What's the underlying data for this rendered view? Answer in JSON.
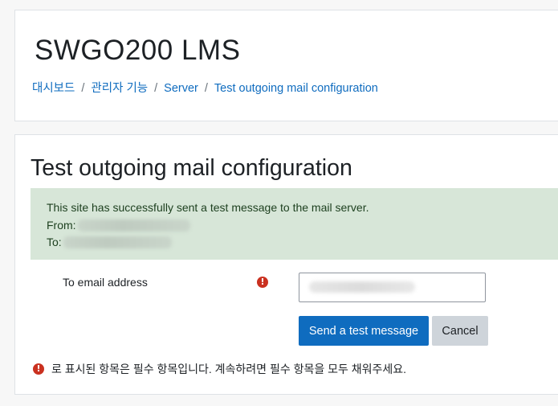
{
  "header": {
    "site_title": "SWGO200 LMS",
    "breadcrumb": [
      {
        "label": "대시보드"
      },
      {
        "label": "관리자 기능"
      },
      {
        "label": "Server"
      },
      {
        "label": "Test outgoing mail configuration"
      }
    ],
    "separator": "/"
  },
  "main": {
    "heading": "Test outgoing mail configuration",
    "alert": {
      "message": "This site has successfully sent a test message to the mail server.",
      "from_label": "From:",
      "to_label": "To:"
    },
    "form": {
      "email_label": "To email address",
      "email_value": "",
      "required_icon": "exclamation-circle-icon",
      "send_button": "Send a test message",
      "cancel_button": "Cancel",
      "required_note": "로 표시된 항목은 필수 항목입니다. 계속하려면 필수 항목을 모두 채워주세요."
    }
  },
  "colors": {
    "accent": "#0f6cbf",
    "alert_bg": "#d7e6d8",
    "required": "#ca3120",
    "secondary_button": "#ced4da"
  }
}
